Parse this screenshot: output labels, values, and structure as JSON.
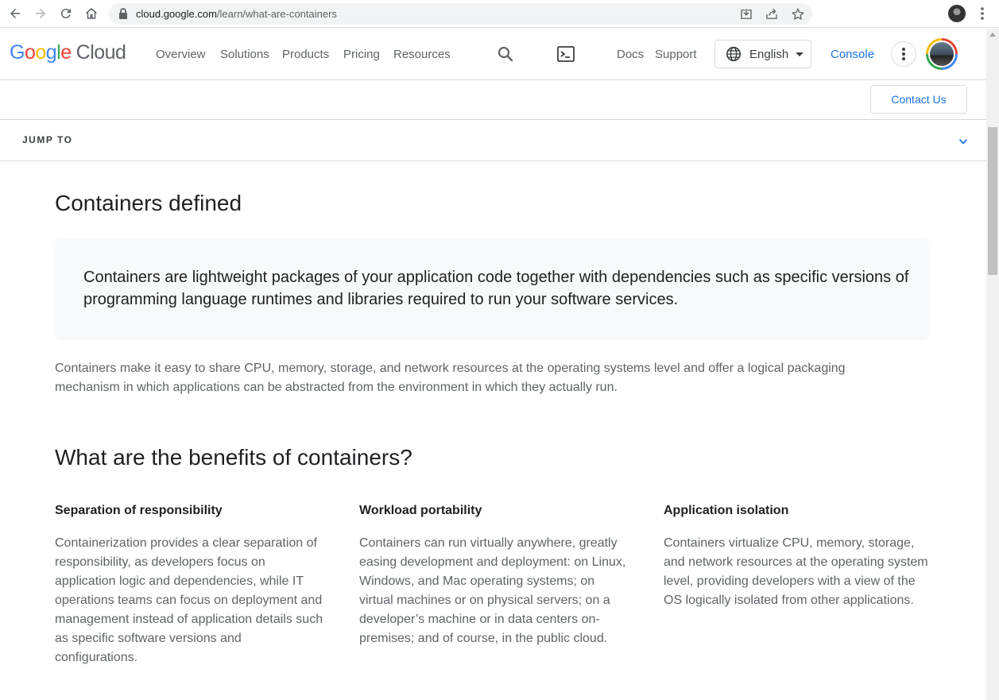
{
  "browser": {
    "url_domain": "cloud.google.com",
    "url_path": "/learn/what-are-containers"
  },
  "header": {
    "logo_letters": [
      "G",
      "o",
      "o",
      "g",
      "l",
      "e"
    ],
    "logo_cloud": "Cloud",
    "nav": [
      "Overview",
      "Solutions",
      "Products",
      "Pricing",
      "Resources"
    ],
    "docs": "Docs",
    "support": "Support",
    "language": "English",
    "console": "Console"
  },
  "contact_button": "Contact Us",
  "jump_to": "JUMP TO",
  "content": {
    "heading_defined": "Containers defined",
    "callout": "Containers are lightweight packages of your application code together with dependencies such as specific versions of programming language runtimes and libraries required to run your software services.",
    "paragraph": "Containers make it easy to share CPU, memory, storage, and network resources at the operating systems level and offer a logical packaging mechanism in which applications can be abstracted from the environment in which they actually run.",
    "heading_benefits": "What are the benefits of containers?",
    "benefits": [
      {
        "title": "Separation of responsibility",
        "body": "Containerization provides a clear separation of responsibility, as developers focus on application logic and dependencies, while IT operations teams can focus on deployment and management instead of application details such as specific software versions and configurations."
      },
      {
        "title": "Workload portability",
        "body": "Containers can run virtually anywhere, greatly easing development and deployment: on Linux, Windows, and Mac operating systems; on virtual machines or on physical servers; on a developer’s machine or in data centers on-premises; and of course, in the public cloud."
      },
      {
        "title": "Application isolation",
        "body": "Containers virtualize CPU, memory, storage, and network resources at the operating system level, providing developers with a view of the OS logically isolated from other applications."
      }
    ]
  },
  "colors": {
    "accent_blue": "#1a73e8",
    "text_primary": "#202124",
    "text_secondary": "#5f6368",
    "callout_bg": "#f8f9fa"
  },
  "icons": [
    "back-icon",
    "forward-icon",
    "reload-icon",
    "home-icon",
    "lock-icon",
    "install-icon",
    "share-icon",
    "star-icon",
    "search-icon",
    "terminal-icon",
    "globe-icon",
    "more-vert-icon",
    "chevron-down-icon"
  ]
}
